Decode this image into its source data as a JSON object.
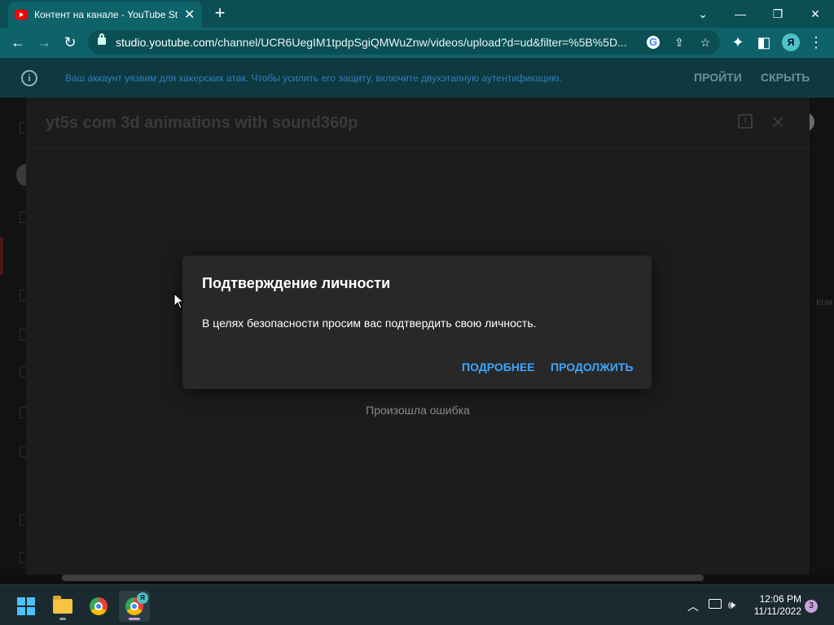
{
  "browser": {
    "tab": {
      "title": "Контент на канале - YouTube Studio",
      "close": "✕"
    },
    "new_tab": "+",
    "window": {
      "minimize": "⌄",
      "restore": "—",
      "maximize": "❐",
      "close": "✕"
    },
    "nav": {
      "back": "←",
      "forward": "→",
      "reload": "↻"
    },
    "url": {
      "host": "studio.youtube.com",
      "path": "/channel/UCR6UegIM1tpdpSgiQMWuZnw/videos/upload?d=ud&filter=%5B%5D..."
    },
    "profile_initial": "Я",
    "menu": "⋮"
  },
  "banner": {
    "message": "Ваш аккаунт уязвим для хакерских атак. Чтобы усилить его защиту, включите двухэтапную аутентификацию.",
    "go_label": "ПРОЙТИ",
    "hide_label": "СКРЫТЬ"
  },
  "upload": {
    "title": "yt5s com 3d animations with sound360p",
    "error": "Произошла ошибка",
    "right_partial": "Ком"
  },
  "dialog": {
    "title": "Подтверждение личности",
    "body": "В целях безопасности просим вас подтвердить свою личность.",
    "more_label": "ПОДРОБНЕЕ",
    "continue_label": "ПРОДОЛЖИТЬ"
  },
  "taskbar": {
    "chrome_profile_badge": "Я",
    "clock_time": "12:06 PM",
    "clock_date": "11/11/2022",
    "notifications": "3"
  },
  "colors": {
    "accent_link": "#3ea6ff",
    "browser_frame": "#0e6269",
    "youtube_red": "#ff0000"
  }
}
